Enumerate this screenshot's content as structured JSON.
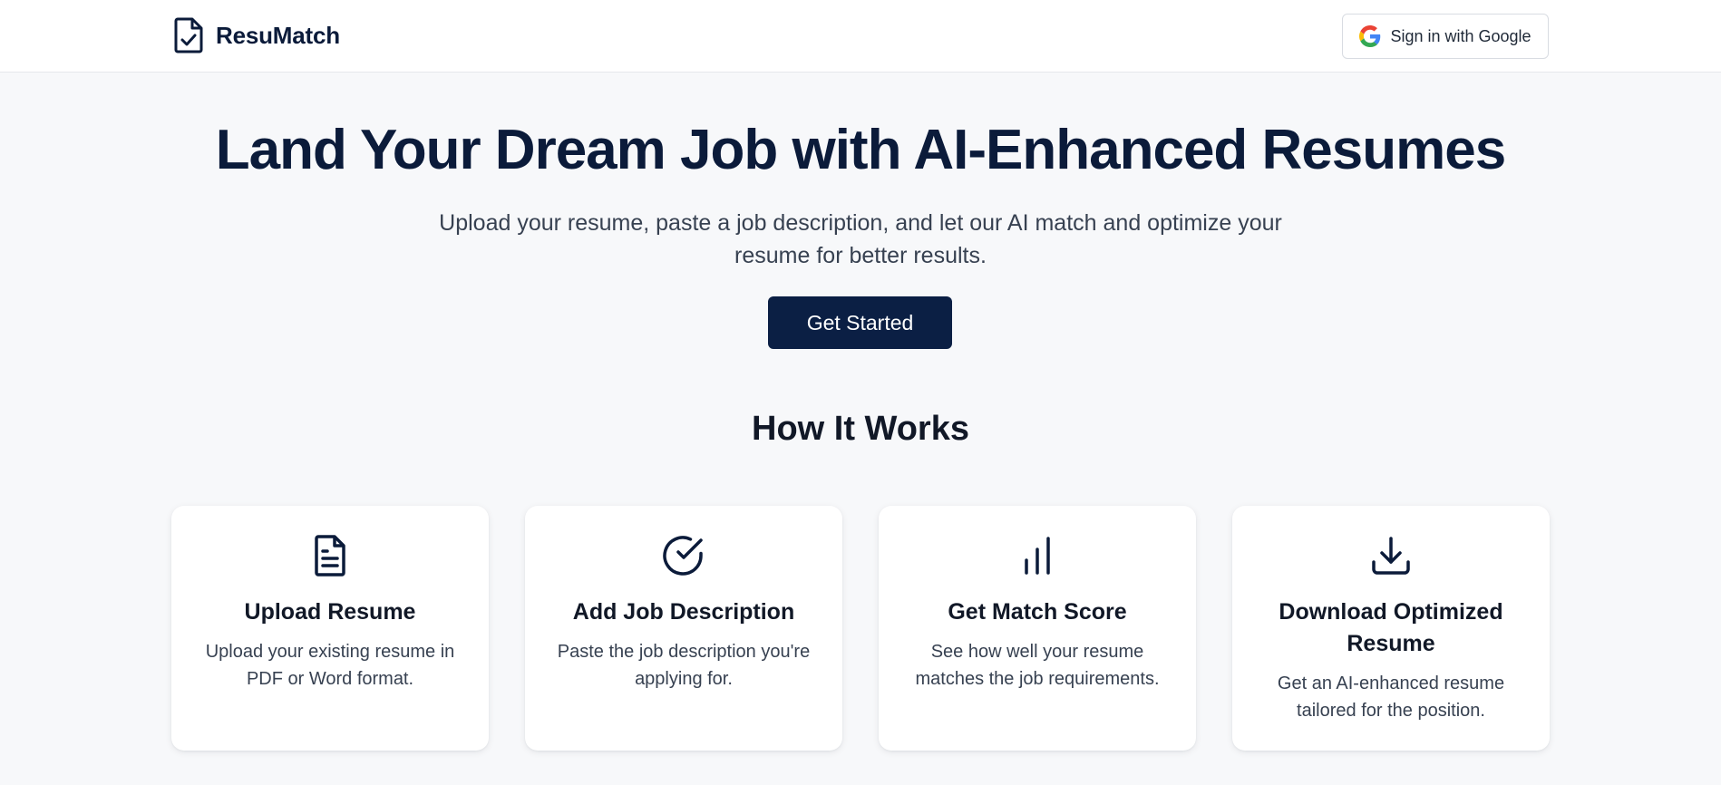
{
  "header": {
    "brand_name": "ResuMatch",
    "brand_icon": "document-check-icon",
    "signin_label": "Sign in with Google",
    "signin_icon": "google-icon"
  },
  "hero": {
    "title": "Land Your Dream Job with AI-Enhanced Resumes",
    "subtitle": "Upload your resume, paste a job description, and let our AI match and optimize your resume for better results.",
    "cta_label": "Get Started"
  },
  "how_it_works": {
    "title": "How It Works",
    "steps": [
      {
        "icon": "document-icon",
        "title": "Upload Resume",
        "description": "Upload your existing resume in PDF or Word format."
      },
      {
        "icon": "check-circle-icon",
        "title": "Add Job Description",
        "description": "Paste the job description you're applying for."
      },
      {
        "icon": "bar-chart-icon",
        "title": "Get Match Score",
        "description": "See how well your resume matches the job requirements."
      },
      {
        "icon": "download-icon",
        "title": "Download Optimized Resume",
        "description": "Get an AI-enhanced resume tailored for the position."
      }
    ]
  },
  "colors": {
    "primary": "#0b1f44",
    "page_background": "#f7f8fa",
    "card_background": "#ffffff",
    "heading": "#0b1b3a",
    "body_text": "#374151"
  }
}
